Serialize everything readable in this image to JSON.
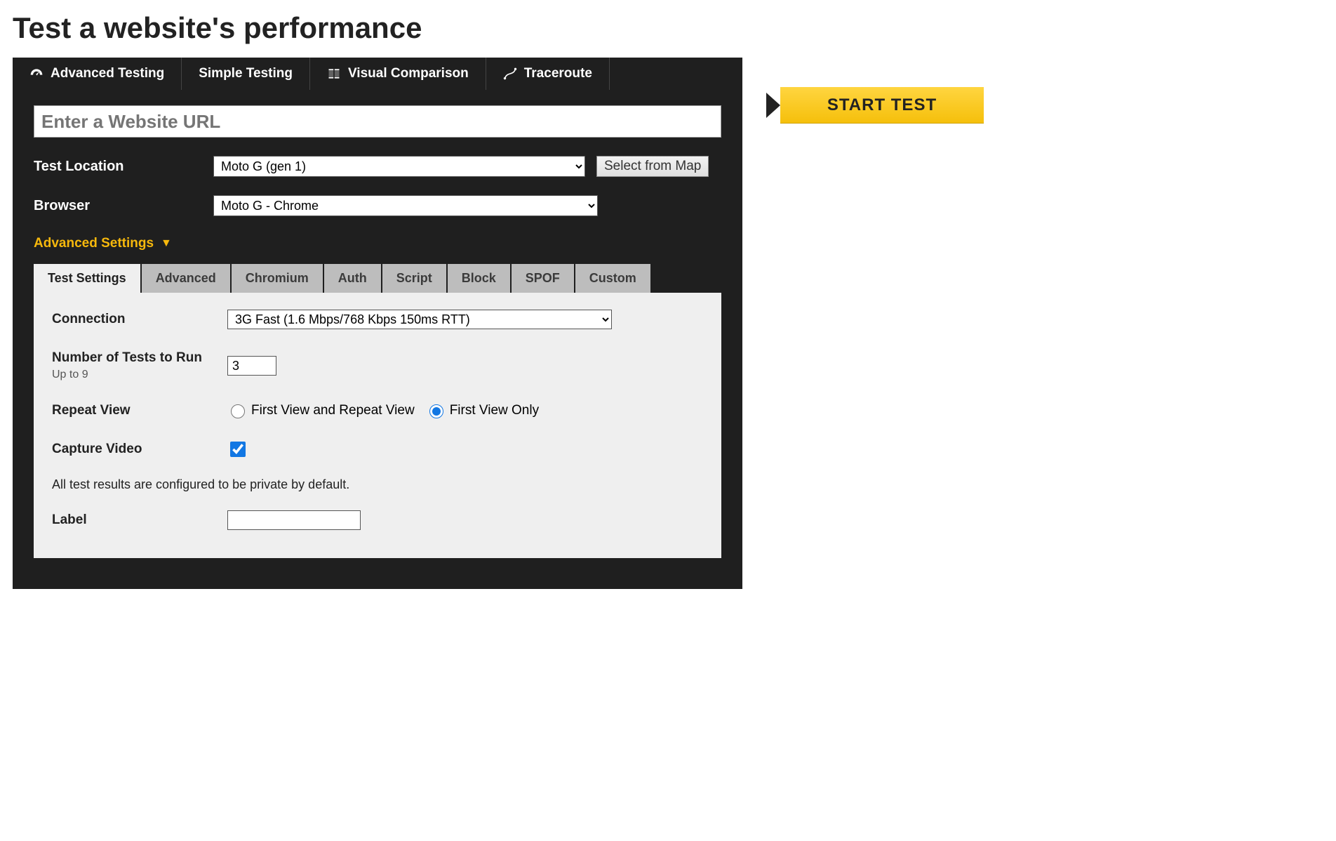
{
  "title": "Test a website's performance",
  "tabs": {
    "advanced": "Advanced Testing",
    "simple": "Simple Testing",
    "visual": "Visual Comparison",
    "traceroute": "Traceroute"
  },
  "url_placeholder": "Enter a Website URL",
  "labels": {
    "location": "Test Location",
    "browser": "Browser",
    "advanced_settings": "Advanced Settings",
    "map_button": "Select from Map"
  },
  "location_value": "Moto G (gen 1)",
  "browser_value": "Moto G - Chrome",
  "settings_tabs": {
    "test": "Test Settings",
    "advanced": "Advanced",
    "chromium": "Chromium",
    "auth": "Auth",
    "script": "Script",
    "block": "Block",
    "spof": "SPOF",
    "custom": "Custom"
  },
  "settings": {
    "connection_label": "Connection",
    "connection_value": "3G Fast (1.6 Mbps/768 Kbps 150ms RTT)",
    "numtests_label": "Number of Tests to Run",
    "numtests_sub": "Up to 9",
    "numtests_value": "3",
    "repeat_label": "Repeat View",
    "repeat_opt1": "First View and Repeat View",
    "repeat_opt2": "First View Only",
    "video_label": "Capture Video",
    "private_note": "All test results are configured to be private by default.",
    "label_label": "Label"
  },
  "start_label": "START TEST"
}
